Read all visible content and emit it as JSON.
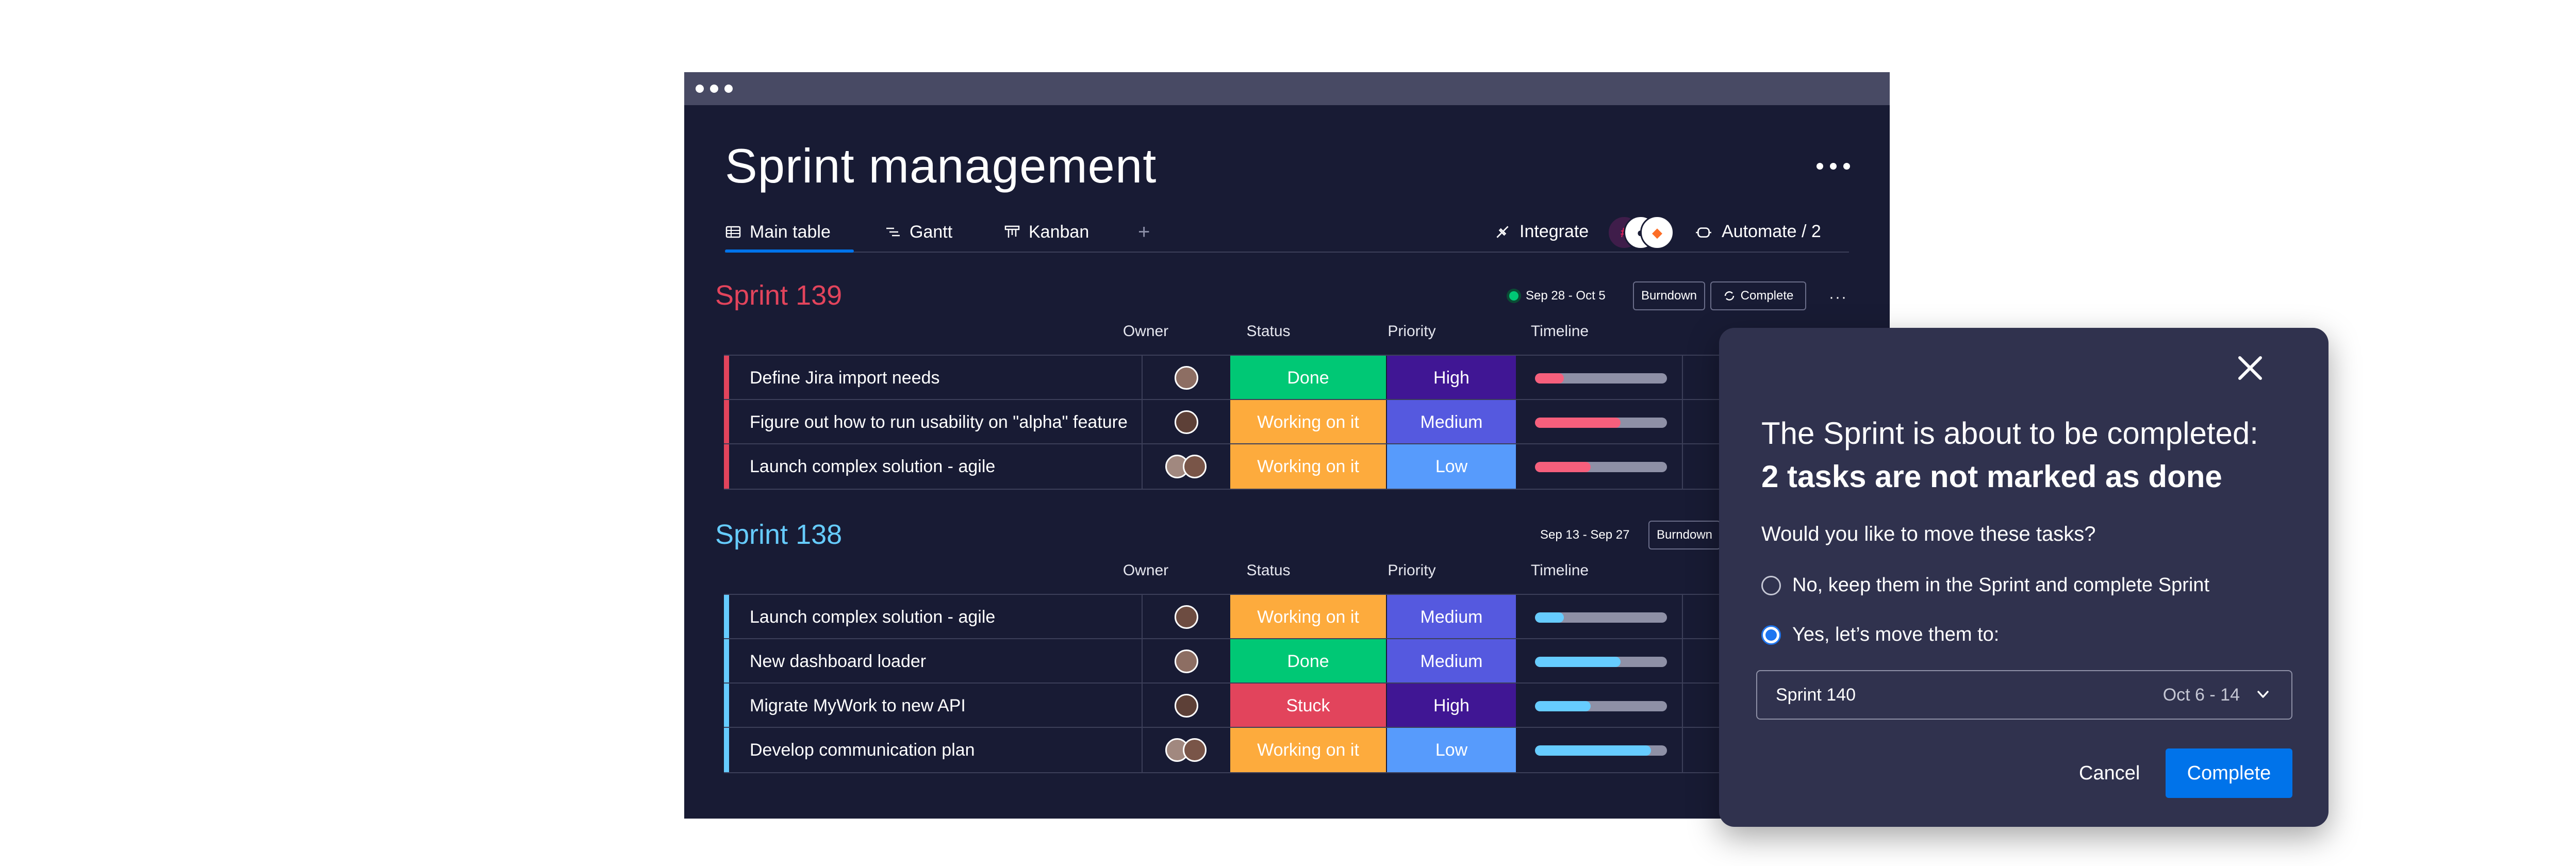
{
  "board": {
    "title": "Sprint management",
    "tabs": [
      {
        "label": "Main table",
        "icon": "table-icon"
      },
      {
        "label": "Gantt",
        "icon": "gantt-icon"
      },
      {
        "label": "Kanban",
        "icon": "kanban-icon"
      }
    ],
    "add_tab": "+",
    "integrate_label": "Integrate",
    "automate_label": "Automate / 2"
  },
  "columns": {
    "owner": "Owner",
    "status": "Status",
    "priority": "Priority",
    "timeline": "Timeline"
  },
  "groups": [
    {
      "title": "Sprint 139",
      "color": "#e2445c",
      "dates": "Sep 28 - Oct 5",
      "burndown": "Burndown",
      "complete": "Complete",
      "rows": [
        {
          "name": "Define Jira import needs",
          "status": "Done",
          "status_color": "#00c875",
          "priority": "High",
          "priority_color": "#401694",
          "progress": 0.22
        },
        {
          "name": "Figure out how to run usability on \"alpha\" feature",
          "status": "Working on it",
          "status_color": "#fdab3d",
          "priority": "Medium",
          "priority_color": "#5559df",
          "progress": 0.65
        },
        {
          "name": "Launch complex solution - agile",
          "status": "Working on it",
          "status_color": "#fdab3d",
          "priority": "Low",
          "priority_color": "#579bfc",
          "progress": 0.42
        }
      ]
    },
    {
      "title": "Sprint 138",
      "color": "#66ccff",
      "dates": "Sep 13 - Sep 27",
      "burndown": "Burndown",
      "rows": [
        {
          "name": "Launch complex solution - agile",
          "status": "Working on it",
          "status_color": "#fdab3d",
          "priority": "Medium",
          "priority_color": "#5559df",
          "progress": 0.22
        },
        {
          "name": "New dashboard loader",
          "status": "Done",
          "status_color": "#00c875",
          "priority": "Medium",
          "priority_color": "#5559df",
          "progress": 0.65
        },
        {
          "name": "Migrate MyWork to new API",
          "status": "Stuck",
          "status_color": "#e2445c",
          "priority": "High",
          "priority_color": "#401694",
          "progress": 0.42
        },
        {
          "name": "Develop communication plan",
          "status": "Working on it",
          "status_color": "#fdab3d",
          "priority": "Low",
          "priority_color": "#579bfc",
          "progress": 0.88
        }
      ]
    }
  ],
  "modal": {
    "line1": "The Sprint is about to be completed:",
    "line2": "2 tasks are not marked as done",
    "question": "Would you like to move these tasks?",
    "option_no": "No, keep them in the Sprint and complete Sprint",
    "option_yes": "Yes, let’s move them to:",
    "selected_option": "yes",
    "select_value": "Sprint 140",
    "select_dates": "Oct 6 - 14",
    "cancel": "Cancel",
    "complete": "Complete"
  }
}
